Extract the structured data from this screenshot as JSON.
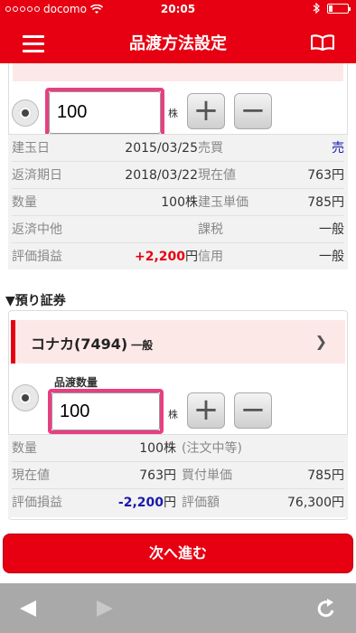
{
  "status": {
    "carrier": "docomo",
    "time": "20:05"
  },
  "nav": {
    "title": "品渡方法設定"
  },
  "card1": {
    "quantity": "100",
    "unit": "株",
    "plus": "+",
    "minus": "−",
    "rows": [
      {
        "l1": "建玉日",
        "v1": "2015/03/25",
        "l2": "売買",
        "v2": "売"
      },
      {
        "l1": "返済期日",
        "v1": "2018/03/22",
        "l2": "現在値",
        "v2": "763円"
      },
      {
        "l1": "数量",
        "v1": "100株",
        "l2": "建玉単価",
        "v2": "785円"
      },
      {
        "l1": "返済中他",
        "v1": "",
        "l2": "課税",
        "v2": "一般"
      },
      {
        "l1": "評価損益",
        "v1": "+2,200",
        "v1_unit": "円",
        "l2": "信用",
        "v2": "一般"
      }
    ]
  },
  "section": {
    "title": "▼預り証券"
  },
  "stock": {
    "name": "コナカ(7494)",
    "kind": "一般",
    "qty_label": "品渡数量",
    "quantity": "100",
    "unit": "株",
    "plus": "+",
    "minus": "−",
    "rows": [
      {
        "l1": "数量",
        "v1": "100株",
        "l2": "(注文中等)",
        "v2": ""
      },
      {
        "l1": "現在値",
        "v1": "763円",
        "l2": "買付単価",
        "v2": "785円"
      },
      {
        "l1": "評価損益",
        "v1": "-2,200",
        "v1_unit": "円",
        "l2": "評価額",
        "v2": "76,300円"
      }
    ]
  },
  "action": {
    "next_label": "次へ進む"
  },
  "colors": {
    "brand": "#e60012",
    "highlight": "#e83f81",
    "gain": "#e60012",
    "loss": "#1a1aaa"
  }
}
